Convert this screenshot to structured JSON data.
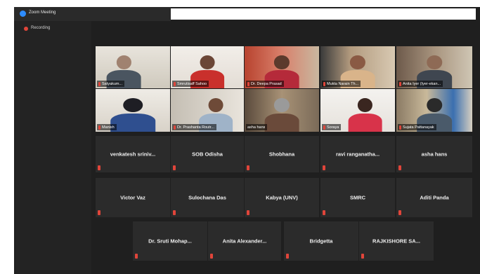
{
  "window": {
    "title": "Zoom Meeting",
    "recording_label": "Recording"
  },
  "colors": {
    "accent": "#2d8cff",
    "muted_mic": "#e0453a",
    "active_speaker": "#c7d44a",
    "tile": "#2b2b2b"
  },
  "video_tiles": [
    {
      "name": "Satyakum..."
    },
    {
      "name": "Smrutisaff Sahoo"
    },
    {
      "name": "Dr. Deepa Prasad"
    },
    {
      "name": "Mukta Narain Th..."
    },
    {
      "name": "Anita Iyer (Iyer-ekan..."
    },
    {
      "name": "Manish"
    },
    {
      "name": "Dr. Prashanta Routr..."
    },
    {
      "name": "asha hans"
    },
    {
      "name": "Soraya"
    },
    {
      "name": "Sujata Pattanayak"
    }
  ],
  "name_tiles": [
    {
      "name": "venkatesh  sriniv..."
    },
    {
      "name": "SOB Odisha"
    },
    {
      "name": "Shobhana"
    },
    {
      "name": "ravi  ranganatha..."
    },
    {
      "name": "asha hans"
    },
    {
      "name": "Victor Vaz"
    },
    {
      "name": "Sulochana Das"
    },
    {
      "name": "Kabya  (UNV)"
    },
    {
      "name": "SMRC"
    },
    {
      "name": "Aditi Panda"
    },
    {
      "name": "Dr. Sruti Mohap..."
    },
    {
      "name": "Anita  Alexander..."
    },
    {
      "name": "Bridgetta"
    },
    {
      "name": "RAJKISHORE SA..."
    }
  ]
}
